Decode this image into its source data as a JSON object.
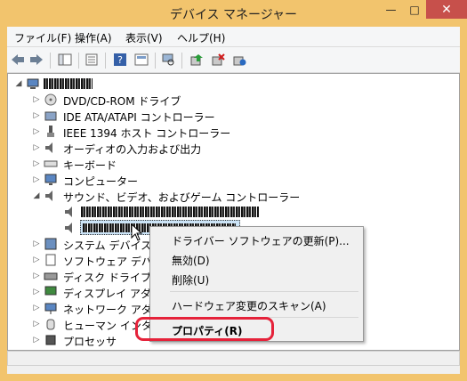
{
  "window": {
    "title": "デバイス マネージャー",
    "min": "—",
    "max": "□",
    "close": "✕"
  },
  "menu": [
    {
      "label": "ファイル(F)"
    },
    {
      "label": "操作(A)"
    },
    {
      "label": "表示(V)"
    },
    {
      "label": "ヘルプ(H)"
    }
  ],
  "toolbar": {
    "icons": [
      "back-icon",
      "forward-icon",
      "show-hide-console-tree-icon",
      "properties-icon",
      "help-icon",
      "device-window-icon",
      "computer-scan-icon",
      "update-driver-icon",
      "disable-device-icon",
      "uninstall-device-icon"
    ]
  },
  "tree": {
    "items": [
      {
        "label": "DVD/CD-ROM ドライブ"
      },
      {
        "label": "IDE ATA/ATAPI コントローラー"
      },
      {
        "label": "IEEE 1394 ホスト コントローラー"
      },
      {
        "label": "オーディオの入力および出力"
      },
      {
        "label": "キーボード"
      },
      {
        "label": "コンピューター"
      },
      {
        "label": "サウンド、ビデオ、およびゲーム コントローラー"
      },
      {
        "label": "システム デバイス"
      },
      {
        "label": "ソフトウェア デバイス"
      },
      {
        "label": "ディスク ドライブ"
      },
      {
        "label": "ディスプレイ アダプター"
      },
      {
        "label": "ネットワーク アダプター"
      },
      {
        "label": "ヒューマン インターフェイス"
      },
      {
        "label": "プロセッサ"
      }
    ]
  },
  "context_menu": {
    "items": [
      {
        "label": "ドライバー ソフトウェアの更新(P)..."
      },
      {
        "label": "無効(D)"
      },
      {
        "label": "削除(U)"
      },
      {
        "label": "ハードウェア変更のスキャン(A)"
      },
      {
        "label": "プロパティ(R)"
      }
    ]
  },
  "colors": {
    "accent_frame": "#f2c46d",
    "close_button": "#c7504b",
    "highlight_ring": "#e5223a"
  }
}
